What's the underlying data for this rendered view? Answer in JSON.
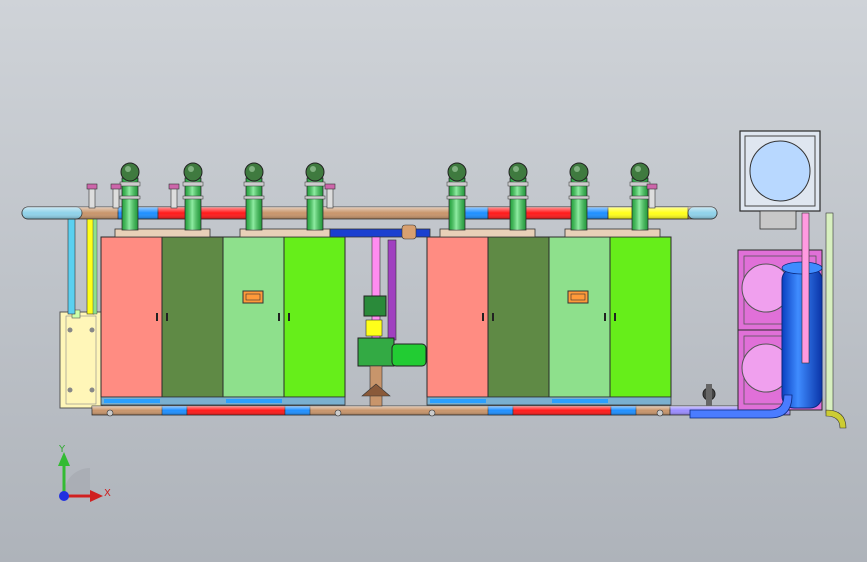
{
  "viewport": {
    "background_top": "#cfd3d8",
    "background_bottom": "#aeb3ba"
  },
  "colors": {
    "header_pipe": "#c8956b",
    "hot_red": "#ff1a1a",
    "cold_blue": "#1e8fff",
    "yellow": "#ffff1a",
    "light_blue": "#8fd2ea",
    "pipe_green": "#33dd55",
    "pink": "#ff8c82",
    "olive": "#5f8a45",
    "light_green": "#8ee08c",
    "bright_green": "#66ee1a",
    "magenta": "#ff8cf0",
    "purple": "#9b8cff",
    "dark_blue": "#1a40d0",
    "tank_blue": "#1e6cff",
    "outline": "#2a2a2a"
  },
  "triad": {
    "y_label": "Y",
    "x_label": "X",
    "icon": "coordinate-triad-icon"
  }
}
